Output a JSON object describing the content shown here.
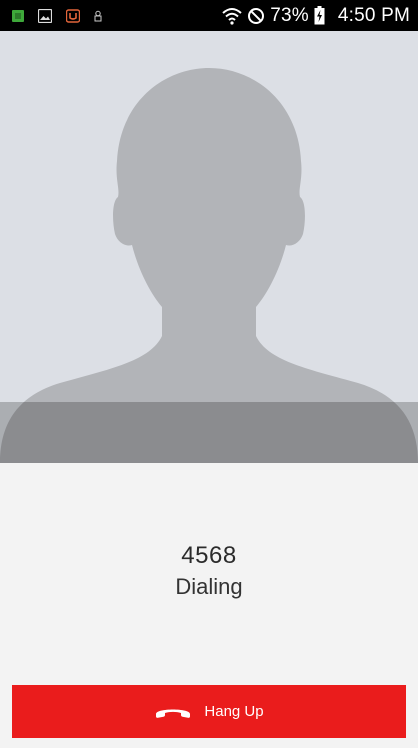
{
  "status_bar": {
    "battery": "73%",
    "time": "4:50 PM",
    "icons": [
      "app-notification-icon",
      "gallery-notification-icon",
      "launcher-notification-icon",
      "lock-notification-icon",
      "wifi-icon",
      "do-not-disturb-icon",
      "battery-charging-icon"
    ]
  },
  "call": {
    "number": "4568",
    "status": "Dialing"
  },
  "actions": {
    "hang_up_label": "Hang Up"
  },
  "colors": {
    "hang_up": "#ea1c1c",
    "photo_background": "#dcdfe5",
    "silhouette": "#b2b4b8"
  }
}
